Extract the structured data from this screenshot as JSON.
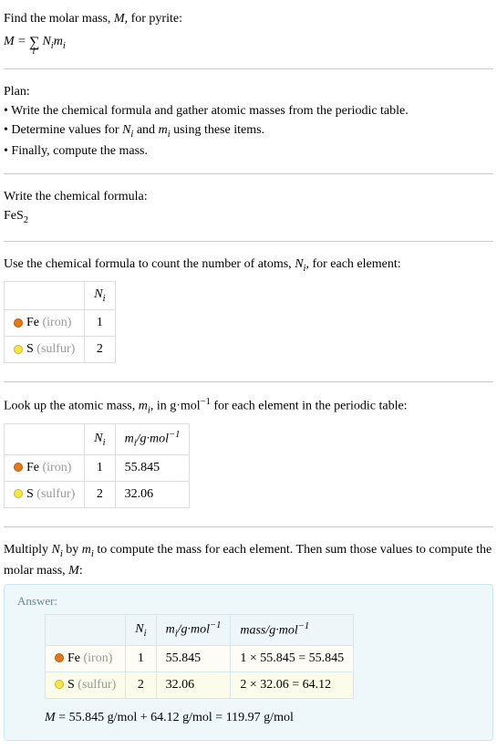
{
  "intro": {
    "line1_prefix": "Find the molar mass, ",
    "line1_var": "M",
    "line1_suffix": ", for pyrite:"
  },
  "plan": {
    "heading": "Plan:",
    "bullet1": "• Write the chemical formula and gather atomic masses from the periodic table.",
    "bullet2_prefix": "• Determine values for ",
    "bullet2_mid": " and ",
    "bullet2_suffix": " using these items.",
    "bullet3": "• Finally, compute the mass."
  },
  "formula_section": {
    "heading": "Write the chemical formula:",
    "formula_main": "FeS",
    "formula_sub": "2"
  },
  "count_section": {
    "text_prefix": "Use the chemical formula to count the number of atoms, ",
    "text_suffix": ", for each element:"
  },
  "elements": {
    "iron": {
      "symbol": "Fe",
      "name": "(iron)",
      "N": "1",
      "m": "55.845",
      "mass_calc": "1 × 55.845 = 55.845"
    },
    "sulfur": {
      "symbol": "S",
      "name": "(sulfur)",
      "N": "2",
      "m": "32.06",
      "mass_calc": "2 × 32.06 = 64.12"
    }
  },
  "lookup_section": {
    "text_prefix": "Look up the atomic mass, ",
    "text_mid": ", in g·mol",
    "text_sup": "−1",
    "text_suffix": " for each element in the periodic table:"
  },
  "headers": {
    "Ni_main": "N",
    "Ni_sub": "i",
    "mi_main": "m",
    "mi_sub": "i",
    "mi_unit_main": "/g·mol",
    "mi_unit_sup": "−1",
    "mass_main": "mass/g·mol",
    "mass_sup": "−1"
  },
  "multiply_section": {
    "text_p1": "Multiply ",
    "text_p2": " by ",
    "text_p3": " to compute the mass for each element. Then sum those values to compute the molar mass, ",
    "text_var": "M",
    "text_p4": ":"
  },
  "answer": {
    "label": "Answer:",
    "final_var": "M",
    "final_text": " = 55.845 g/mol + 64.12 g/mol = 119.97 g/mol"
  }
}
